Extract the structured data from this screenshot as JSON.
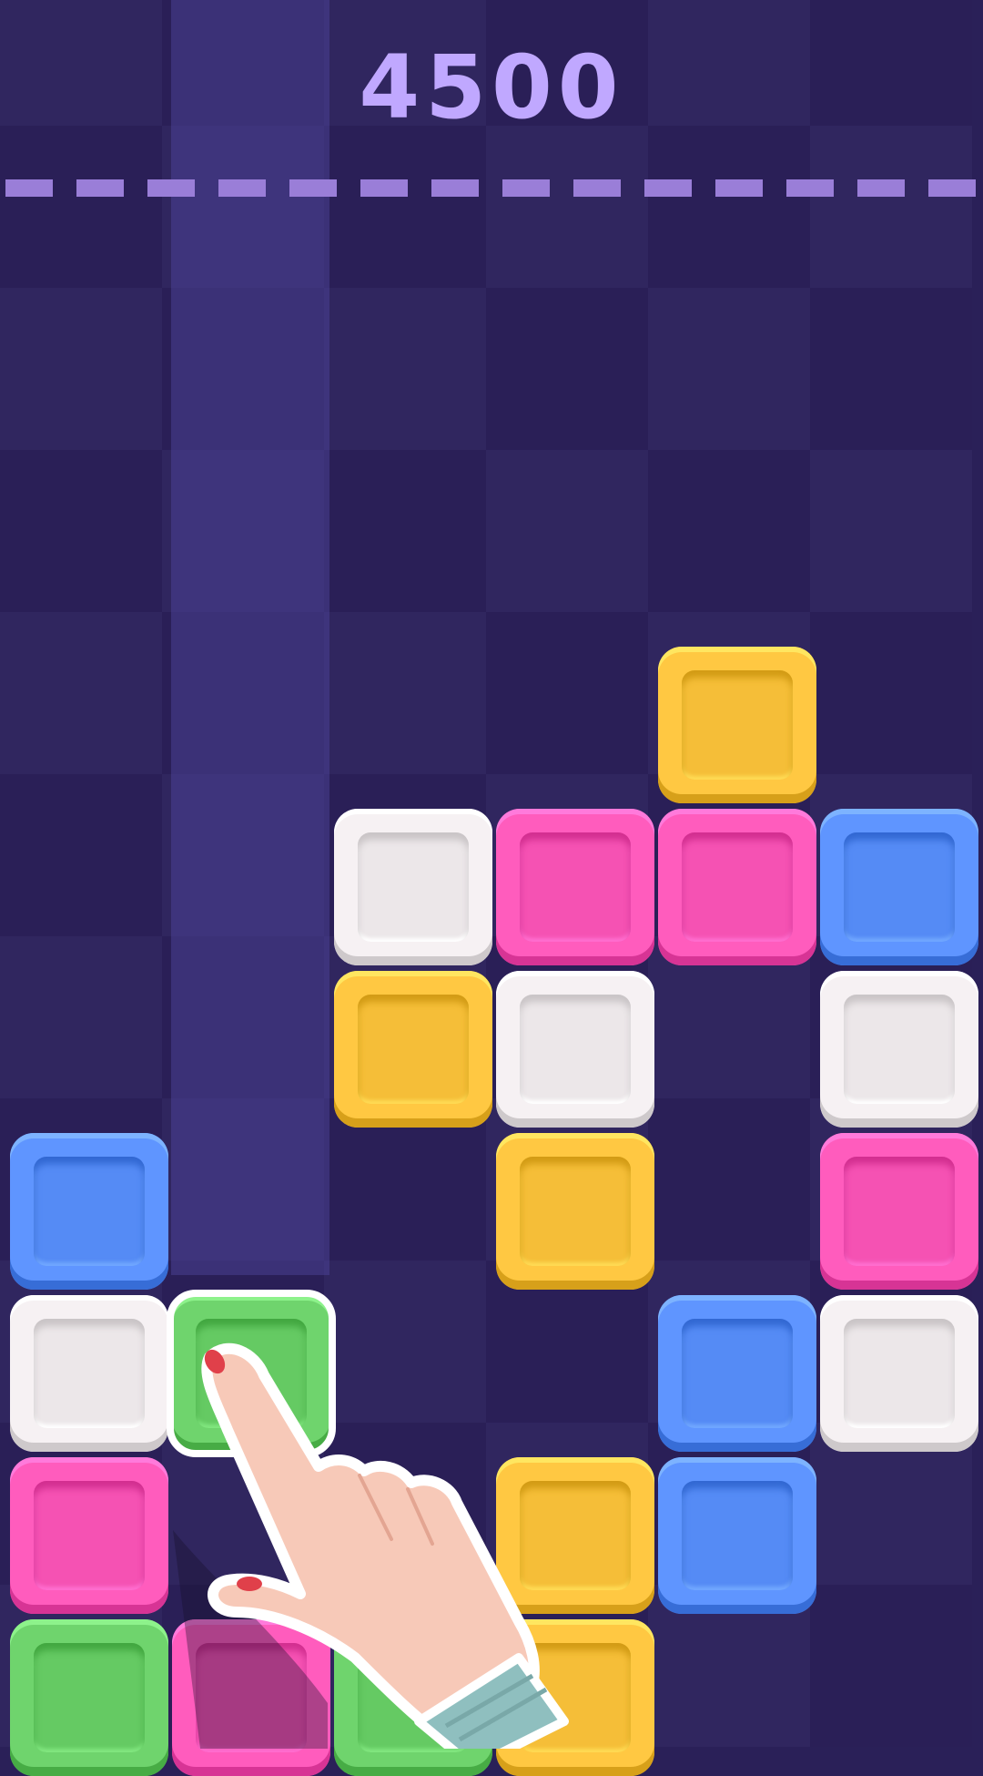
{
  "score": "4500",
  "colors": {
    "background": "#2a2058",
    "checker_dark": "#2a1f57",
    "checker_light": "#30265f",
    "score_text": "#c0a8ff",
    "dash": "#9a7ed8",
    "yellow": "#ffc842",
    "white": "#f6f1f3",
    "pink": "#ff5cbd",
    "blue": "#5f95ff",
    "green": "#6fd46d"
  },
  "grid": {
    "columns": 6,
    "rows": 11
  },
  "highlighted_column": 1,
  "selected_block": {
    "row": 8,
    "col": 1
  },
  "blocks": [
    {
      "row": 4,
      "col": 4,
      "color": "yellow"
    },
    {
      "row": 5,
      "col": 2,
      "color": "white"
    },
    {
      "row": 5,
      "col": 3,
      "color": "pink"
    },
    {
      "row": 5,
      "col": 4,
      "color": "pink"
    },
    {
      "row": 5,
      "col": 5,
      "color": "blue"
    },
    {
      "row": 6,
      "col": 2,
      "color": "yellow"
    },
    {
      "row": 6,
      "col": 3,
      "color": "white"
    },
    {
      "row": 6,
      "col": 5,
      "color": "white"
    },
    {
      "row": 7,
      "col": 0,
      "color": "blue"
    },
    {
      "row": 7,
      "col": 3,
      "color": "yellow"
    },
    {
      "row": 7,
      "col": 5,
      "color": "pink"
    },
    {
      "row": 8,
      "col": 0,
      "color": "white"
    },
    {
      "row": 8,
      "col": 1,
      "color": "green"
    },
    {
      "row": 8,
      "col": 4,
      "color": "blue"
    },
    {
      "row": 8,
      "col": 5,
      "color": "white"
    },
    {
      "row": 9,
      "col": 0,
      "color": "pink"
    },
    {
      "row": 9,
      "col": 3,
      "color": "yellow"
    },
    {
      "row": 9,
      "col": 4,
      "color": "blue"
    },
    {
      "row": 10,
      "col": 0,
      "color": "green"
    },
    {
      "row": 10,
      "col": 1,
      "color": "pink"
    },
    {
      "row": 10,
      "col": 2,
      "color": "green"
    },
    {
      "row": 10,
      "col": 3,
      "color": "yellow"
    }
  ],
  "tutorial_hand": {
    "icon": "pointing-hand-icon"
  }
}
